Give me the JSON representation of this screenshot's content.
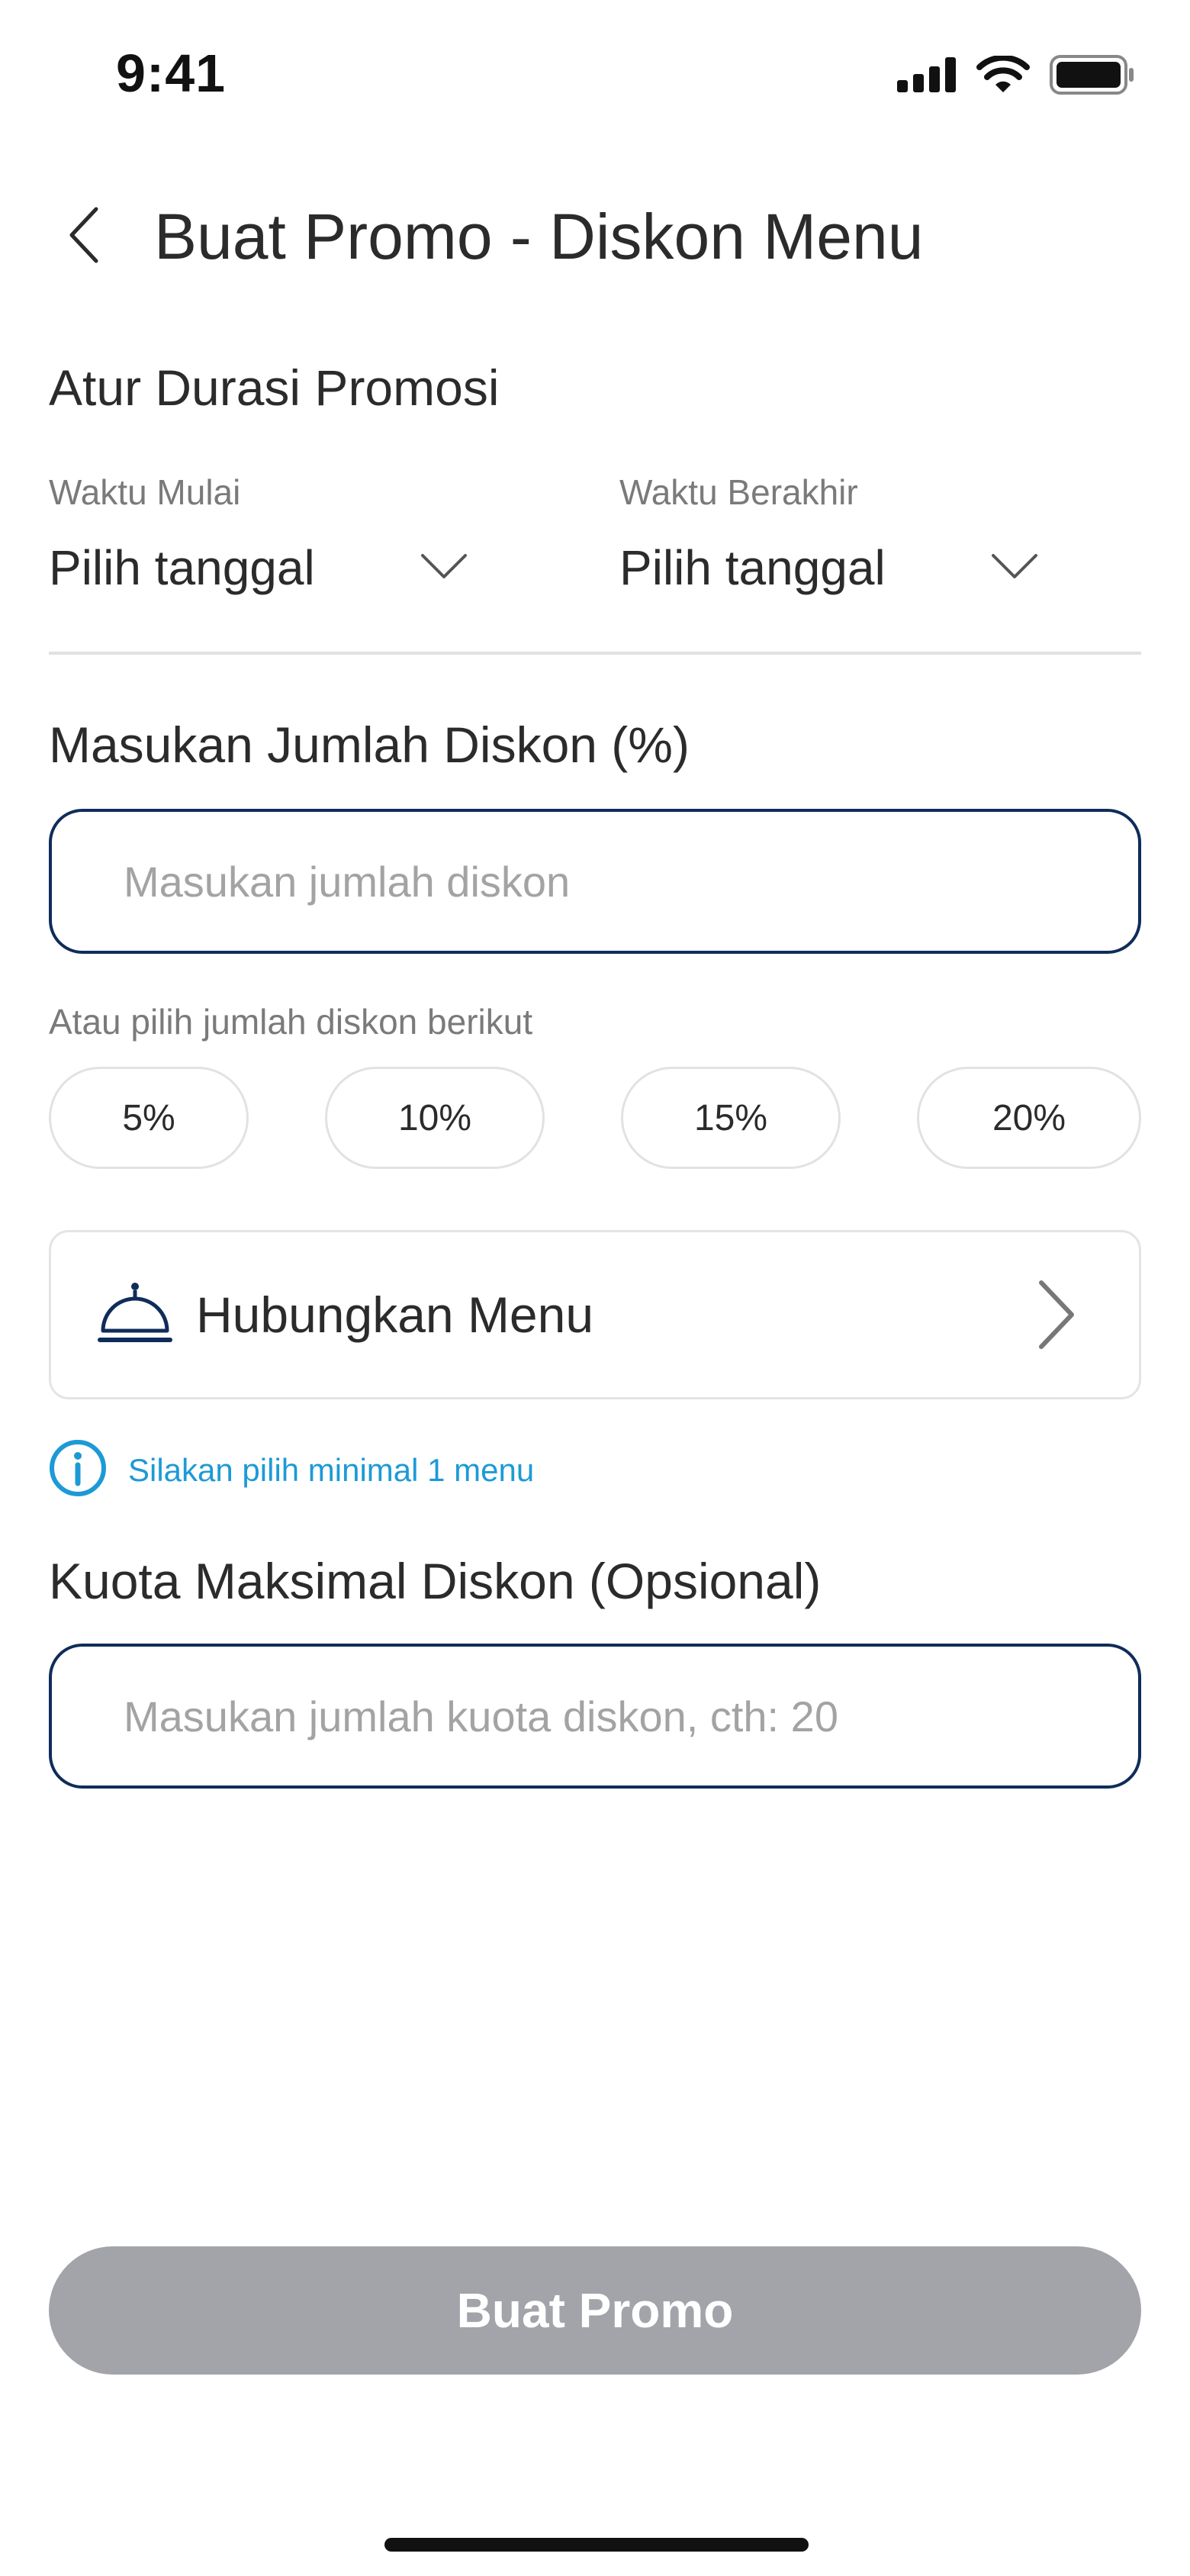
{
  "status_bar": {
    "time": "9:41",
    "icons": [
      "cellular-signal-icon",
      "wifi-icon",
      "battery-icon"
    ]
  },
  "header": {
    "back_icon": "chevron-left-icon",
    "title": "Buat Promo - Diskon Menu"
  },
  "duration": {
    "section_title": "Atur Durasi Promosi",
    "start": {
      "label": "Waktu Mulai",
      "value": "Pilih tanggal"
    },
    "end": {
      "label": "Waktu Berakhir",
      "value": "Pilih tanggal"
    }
  },
  "discount": {
    "section_title": "Masukan Jumlah Diskon (%)",
    "placeholder": "Masukan jumlah diskon",
    "value": "",
    "preset_hint": "Atau pilih jumlah diskon berikut",
    "presets": [
      "5%",
      "10%",
      "15%",
      "20%"
    ]
  },
  "menu_link": {
    "icon": "cloche-icon",
    "label": "Hubungkan Menu",
    "chevron": "chevron-right-icon",
    "info_icon": "info-icon",
    "info_text": "Silakan pilih minimal 1 menu"
  },
  "quota": {
    "section_title": "Kuota Maksimal Diskon (Opsional)",
    "placeholder": "Masukan jumlah kuota diskon, cth: 20",
    "value": ""
  },
  "submit": {
    "label": "Buat Promo",
    "state": "disabled"
  },
  "colors": {
    "accent_navy": "#0f2c5a",
    "info_blue": "#1d9ad6",
    "disabled_button": "#a2a4aa",
    "text": "#2b2b2b",
    "muted_text": "#7a7a7a"
  }
}
